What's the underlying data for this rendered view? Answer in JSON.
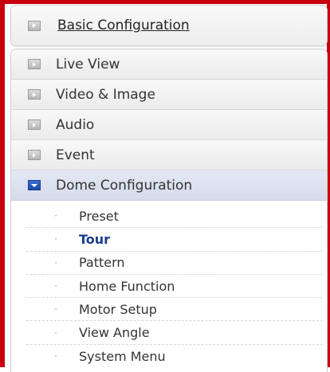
{
  "basic": {
    "label": "Basic Configuration",
    "icon": "expand-arrow-icon"
  },
  "menu": [
    {
      "label": "Live View",
      "icon": "expand-arrow-icon"
    },
    {
      "label": "Video & Image",
      "icon": "expand-arrow-icon"
    },
    {
      "label": "Audio",
      "icon": "expand-arrow-icon"
    },
    {
      "label": "Event",
      "icon": "expand-arrow-icon"
    },
    {
      "label": "Dome Configuration",
      "icon": "collapse-arrow-icon",
      "expanded": true
    }
  ],
  "submenu": [
    {
      "label": "Preset"
    },
    {
      "label": "Tour",
      "active": true
    },
    {
      "label": "Pattern"
    },
    {
      "label": "Home Function"
    },
    {
      "label": "Motor Setup"
    },
    {
      "label": "View Angle"
    },
    {
      "label": "System Menu"
    }
  ],
  "colors": {
    "frame": "#c8000e",
    "active_text": "#1a3d8f",
    "active_icon": "#1b4aa8"
  }
}
